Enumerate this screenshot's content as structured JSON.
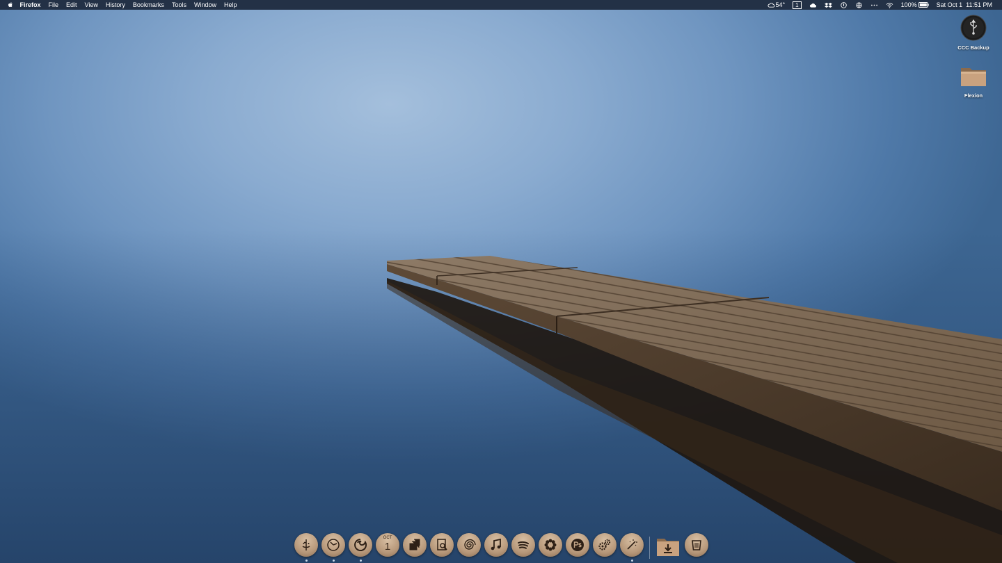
{
  "menubar": {
    "app_name": "Firefox",
    "menus": [
      "File",
      "Edit",
      "View",
      "History",
      "Bookmarks",
      "Tools",
      "Window",
      "Help"
    ],
    "weather": "54°",
    "desktop_number": "1",
    "battery": "100%",
    "datetime": "Sat Oct 1  11:51 PM"
  },
  "desktop": {
    "icons": [
      {
        "label": "CCC Backup",
        "icon": "usb-drive-icon"
      },
      {
        "label": "Flexion",
        "icon": "folder-icon"
      }
    ]
  },
  "dock": {
    "calendar_month": "OCT",
    "calendar_day": "1",
    "apps": [
      {
        "icon": "finder-icon",
        "running": true
      },
      {
        "icon": "clock-icon",
        "running": true
      },
      {
        "icon": "firefox-icon",
        "running": true
      },
      {
        "icon": "calendar-icon",
        "running": false
      },
      {
        "icon": "stack-icon",
        "running": false
      },
      {
        "icon": "preview-icon",
        "running": false
      },
      {
        "icon": "shell-icon",
        "running": false
      },
      {
        "icon": "music-icon",
        "running": false
      },
      {
        "icon": "spotify-icon",
        "running": false
      },
      {
        "icon": "flower-icon",
        "running": false
      },
      {
        "icon": "photoshop-icon",
        "running": false
      },
      {
        "icon": "gears-icon",
        "running": false
      },
      {
        "icon": "magic-wand-icon",
        "running": true
      },
      {
        "icon": "downloads-icon",
        "running": false
      },
      {
        "icon": "trash-icon",
        "running": false
      }
    ]
  },
  "colors": {
    "menubar": "#233146",
    "sky_light": "#a4bfdc",
    "water_dark": "#3d6692",
    "dock_bronze": "#b7987a",
    "pier_wood": "#8a7560"
  }
}
